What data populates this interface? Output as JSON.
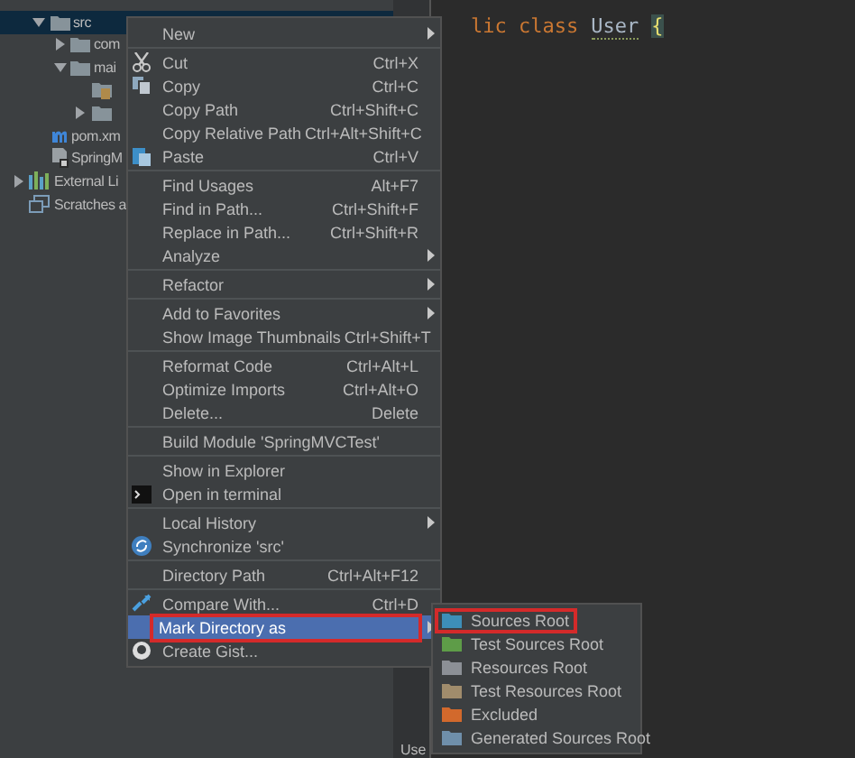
{
  "tree": {
    "module_items": [
      {
        "name": "src",
        "kind": "folder",
        "expanded": true,
        "selected": true,
        "children": [
          {
            "name": "com",
            "kind": "folder",
            "expanded": false,
            "selected": false
          },
          {
            "name": "mai",
            "kind": "folder",
            "expanded": true,
            "selected": false,
            "children": [
              {
                "kind": "resource",
                "selected": false
              },
              {
                "kind": "folder",
                "expanded": false,
                "selected": false
              }
            ]
          }
        ]
      },
      {
        "name": "pom.xm",
        "kind": "maven",
        "selected": false
      },
      {
        "name": "SpringM",
        "kind": "module",
        "selected": false
      }
    ],
    "items": [
      {
        "name": "External Li",
        "kind": "library",
        "expanded": false,
        "selected": false
      },
      {
        "name": "Scratches a",
        "kind": "scratch",
        "selected": false
      }
    ]
  },
  "editor": {
    "code": [
      {
        "text": "lic class",
        "kind": "keyword"
      },
      {
        "text": "User",
        "kind": "ident"
      },
      {
        "text": "{",
        "kind": "brace"
      }
    ],
    "tab": "Use"
  },
  "context_menu": {
    "groups": [
      [
        {
          "label": "New",
          "submenu": true,
          "selected": false,
          "outlined": false
        }
      ],
      [
        {
          "label": "Cut",
          "shortcut": "Ctrl+X",
          "submenu": false,
          "selected": false,
          "outlined": false
        },
        {
          "label": "Copy",
          "shortcut": "Ctrl+C",
          "submenu": false,
          "selected": false,
          "outlined": false
        },
        {
          "label": "Copy Path",
          "shortcut": "Ctrl+Shift+C",
          "submenu": false,
          "selected": false,
          "outlined": false
        },
        {
          "label": "Copy Relative Path",
          "shortcut": "Ctrl+Alt+Shift+C",
          "submenu": false,
          "selected": false,
          "outlined": false
        },
        {
          "label": "Paste",
          "shortcut": "Ctrl+V",
          "submenu": false,
          "selected": false,
          "outlined": false
        }
      ],
      [
        {
          "label": "Find Usages",
          "shortcut": "Alt+F7",
          "submenu": false,
          "selected": false,
          "outlined": false
        },
        {
          "label": "Find in Path...",
          "shortcut": "Ctrl+Shift+F",
          "submenu": false,
          "selected": false,
          "outlined": false
        },
        {
          "label": "Replace in Path...",
          "shortcut": "Ctrl+Shift+R",
          "submenu": false,
          "selected": false,
          "outlined": false
        },
        {
          "label": "Analyze",
          "submenu": true,
          "selected": false,
          "outlined": false
        }
      ],
      [
        {
          "label": "Refactor",
          "submenu": true,
          "selected": false,
          "outlined": false
        }
      ],
      [
        {
          "label": "Add to Favorites",
          "submenu": true,
          "selected": false,
          "outlined": false
        },
        {
          "label": "Show Image Thumbnails",
          "shortcut": "Ctrl+Shift+T",
          "submenu": false,
          "selected": false,
          "outlined": false
        }
      ],
      [
        {
          "label": "Reformat Code",
          "shortcut": "Ctrl+Alt+L",
          "submenu": false,
          "selected": false,
          "outlined": false
        },
        {
          "label": "Optimize Imports",
          "shortcut": "Ctrl+Alt+O",
          "submenu": false,
          "selected": false,
          "outlined": false
        },
        {
          "label": "Delete...",
          "shortcut": "Delete",
          "submenu": false,
          "selected": false,
          "outlined": false
        }
      ],
      [
        {
          "label": "Build Module 'SpringMVCTest'",
          "submenu": false,
          "selected": false,
          "outlined": false
        }
      ],
      [
        {
          "label": "Show in Explorer",
          "submenu": false,
          "selected": false,
          "outlined": false
        },
        {
          "label": "Open in terminal",
          "submenu": false,
          "selected": false,
          "outlined": false
        }
      ],
      [
        {
          "label": "Local History",
          "submenu": true,
          "selected": false,
          "outlined": false
        },
        {
          "label": "Synchronize 'src'",
          "submenu": false,
          "selected": false,
          "outlined": false
        }
      ],
      [
        {
          "label": "Directory Path",
          "shortcut": "Ctrl+Alt+F12",
          "submenu": false,
          "selected": false,
          "outlined": false
        }
      ],
      [
        {
          "label": "Compare With...",
          "shortcut": "Ctrl+D",
          "submenu": false,
          "selected": false,
          "outlined": false
        },
        {
          "label": "Mark Directory as",
          "submenu": true,
          "selected": true,
          "outlined": true
        },
        {
          "label": "Create Gist...",
          "submenu": false,
          "selected": false,
          "outlined": false
        }
      ]
    ]
  },
  "submenu": {
    "items": [
      {
        "label": "Sources Root",
        "color": "#3d8fb8",
        "outlined": true
      },
      {
        "label": "Test Sources Root",
        "color": "#5e9c48",
        "outlined": false
      },
      {
        "label": "Resources Root",
        "color": "#8c9096",
        "outlined": false
      },
      {
        "label": "Test Resources Root",
        "color": "#a08c6c",
        "outlined": false
      },
      {
        "label": "Excluded",
        "color": "#d2692c",
        "outlined": false
      },
      {
        "label": "Generated Sources Root",
        "color": "#6f8faa",
        "outlined": false
      }
    ]
  }
}
